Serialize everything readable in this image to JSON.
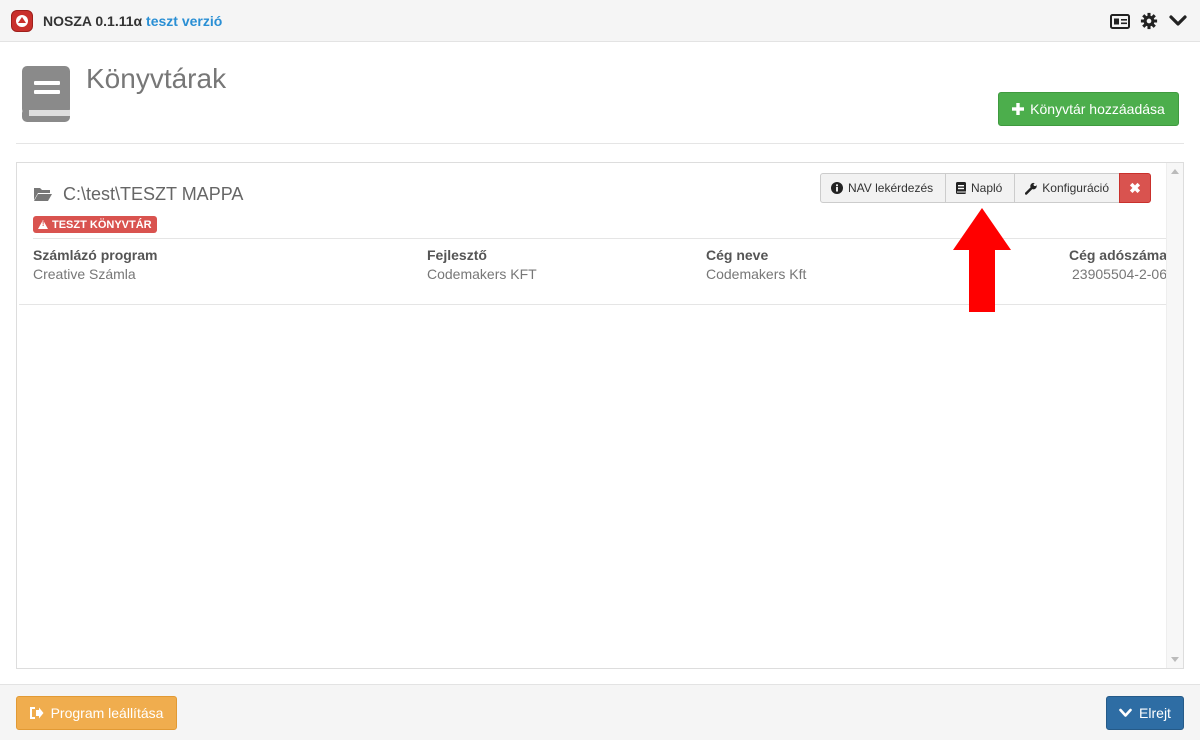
{
  "app": {
    "name": "NOSZA 0.1.11α",
    "version_tag": "teszt verzió"
  },
  "page": {
    "title": "Könyvtárak",
    "add_button_label": "Könyvtár hozzáadása"
  },
  "library": {
    "path": "C:\\test\\TESZT MAPPA",
    "badge": "TESZT KÖNYVTÁR",
    "actions": {
      "nav_query": "NAV lekérdezés",
      "log": "Napló",
      "config": "Konfiguráció",
      "delete": "✖"
    },
    "fields": [
      {
        "label": "Számlázó program",
        "value": "Creative Számla"
      },
      {
        "label": "Fejlesztő",
        "value": "Codemakers KFT"
      },
      {
        "label": "Cég neve",
        "value": "Codemakers Kft"
      },
      {
        "label": "Cég adószáma",
        "value": "23905504-2-06"
      }
    ]
  },
  "footer": {
    "stop_label": "Program leállítása",
    "hide_label": "Elrejt"
  },
  "colors": {
    "success": "#4cae4c",
    "danger": "#d9534f",
    "warning": "#f0ad4e",
    "primary": "#2e6da4",
    "version_tag": "#2a8fd4",
    "annotation_arrow": "#ff0000"
  },
  "icons": {
    "app_logo": "upload-arrow-icon",
    "titlebar": [
      "id-card-icon",
      "gear-icon",
      "chevron-down-icon"
    ],
    "page": "book-icon",
    "folder": "folder-open-icon"
  }
}
